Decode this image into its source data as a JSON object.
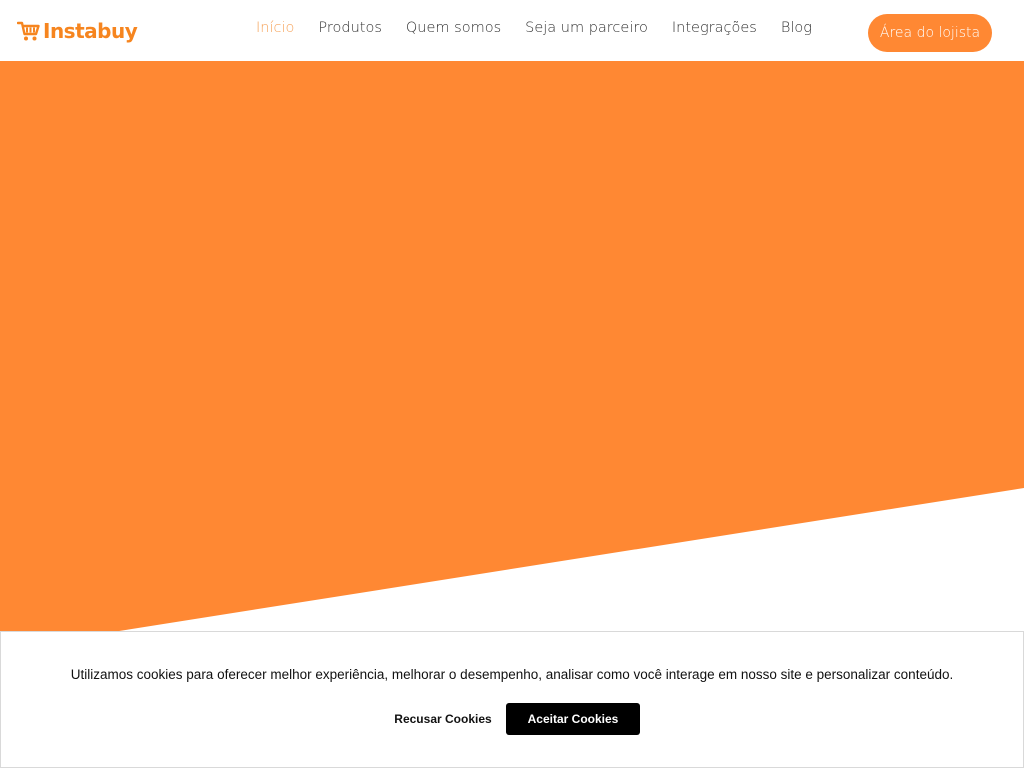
{
  "brand": {
    "name": "Instabuy",
    "logo_icon": "shopping-cart-icon",
    "color": "#f6851f"
  },
  "nav": {
    "items": [
      {
        "label": "Início",
        "active": true
      },
      {
        "label": "Produtos",
        "active": false
      },
      {
        "label": "Quem somos",
        "active": false
      },
      {
        "label": "Seja um parceiro",
        "active": false
      },
      {
        "label": "Integrações",
        "active": false
      },
      {
        "label": "Blog",
        "active": false
      }
    ],
    "active_color": "#f6a35a"
  },
  "header": {
    "cta_label": "Área do lojista"
  },
  "hero": {
    "color": "#ff8833"
  },
  "cookie_banner": {
    "message": "Utilizamos cookies para oferecer melhor experiência, melhorar o desempenho, analisar como você interage em nosso site e personalizar conteúdo.",
    "decline_label": "Recusar Cookies",
    "accept_label": "Aceitar Cookies"
  }
}
